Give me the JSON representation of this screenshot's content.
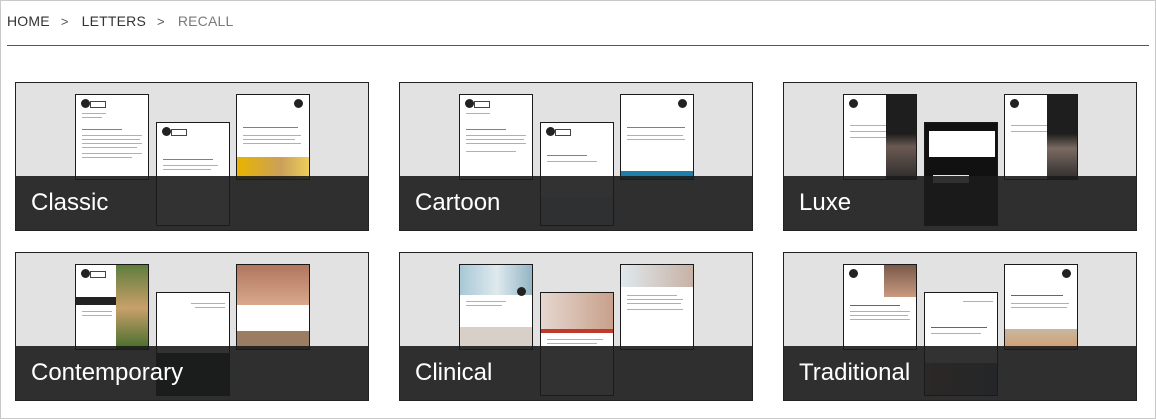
{
  "breadcrumb": {
    "home": "HOME",
    "letters": "LETTERS",
    "current": "RECALL",
    "separator": ">"
  },
  "cards": [
    {
      "label": "Classic"
    },
    {
      "label": "Cartoon"
    },
    {
      "label": "Luxe"
    },
    {
      "label": "Contemporary"
    },
    {
      "label": "Clinical"
    },
    {
      "label": "Traditional"
    }
  ],
  "colors": {
    "card_bg": "#e2e2e2",
    "label_bar": "#1c1c1c",
    "label_text": "#ffffff",
    "breadcrumb_current": "#7a7a7a"
  }
}
